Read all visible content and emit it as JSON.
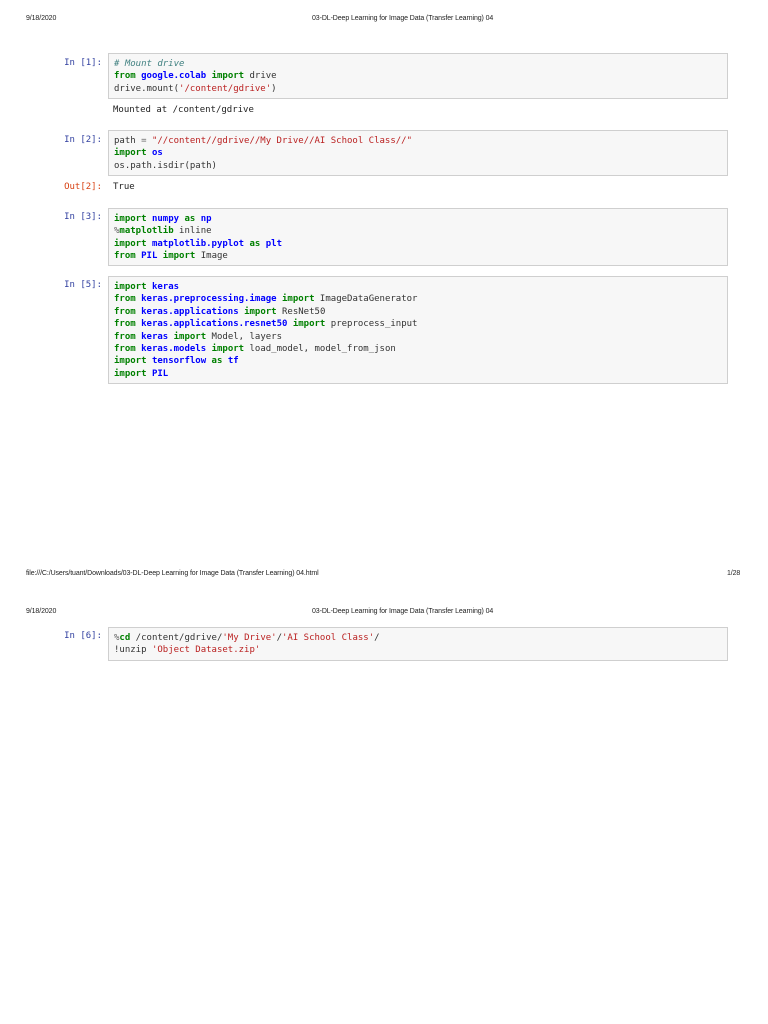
{
  "pages": [
    {
      "date": "9/18/2020",
      "title": "03-DL-Deep Learning for Image Data (Transfer Learning) 04",
      "footer_path": "file:///C:/Users/tuant/Downloads/03-DL-Deep Learning for Image Data (Transfer Learning) 04.html",
      "page_number": "1/28"
    },
    {
      "date": "9/18/2020",
      "title": "03-DL-Deep Learning for Image Data (Transfer Learning) 04"
    }
  ],
  "cells": [
    {
      "prompt": "In [1]:",
      "lines": [
        [
          [
            "# Mount drive",
            "c"
          ]
        ],
        [
          [
            "from",
            "k"
          ],
          [
            " ",
            ""
          ],
          [
            "google.colab",
            "n"
          ],
          [
            " ",
            ""
          ],
          [
            "import",
            "k"
          ],
          [
            " drive",
            ""
          ]
        ],
        [
          [
            "drive.mount(",
            ""
          ],
          [
            "'/content/gdrive'",
            "s"
          ],
          [
            ")",
            ""
          ]
        ]
      ],
      "output": "Mounted at /content/gdrive"
    },
    {
      "prompt": "In [2]:",
      "lines": [
        [
          [
            "path ",
            ""
          ],
          [
            "=",
            "o"
          ],
          [
            " ",
            ""
          ],
          [
            "\"//content//gdrive//My Drive//AI School Class//\"",
            "s"
          ]
        ],
        [
          [
            "import",
            "k"
          ],
          [
            " ",
            ""
          ],
          [
            "os",
            "n"
          ]
        ],
        [
          [
            "os.path.isdir(path)",
            ""
          ]
        ]
      ],
      "out_prompt": "Out[2]:",
      "output": "True"
    },
    {
      "prompt": "In [3]:",
      "lines": [
        [
          [
            "import",
            "k"
          ],
          [
            " ",
            ""
          ],
          [
            "numpy",
            "n"
          ],
          [
            " ",
            ""
          ],
          [
            "as",
            "k"
          ],
          [
            " ",
            ""
          ],
          [
            "np",
            "n"
          ]
        ],
        [
          [
            "%",
            "o"
          ],
          [
            "matplotlib",
            "k"
          ],
          [
            " inline",
            ""
          ]
        ],
        [
          [
            "import",
            "k"
          ],
          [
            " ",
            ""
          ],
          [
            "matplotlib.pyplot",
            "n"
          ],
          [
            " ",
            ""
          ],
          [
            "as",
            "k"
          ],
          [
            " ",
            ""
          ],
          [
            "plt",
            "n"
          ]
        ],
        [
          [
            "from",
            "k"
          ],
          [
            " ",
            ""
          ],
          [
            "PIL",
            "n"
          ],
          [
            " ",
            ""
          ],
          [
            "import",
            "k"
          ],
          [
            " Image",
            ""
          ]
        ]
      ]
    },
    {
      "prompt": "In [5]:",
      "lines": [
        [
          [
            "import",
            "k"
          ],
          [
            " ",
            ""
          ],
          [
            "keras",
            "n"
          ]
        ],
        [
          [
            "from",
            "k"
          ],
          [
            " ",
            ""
          ],
          [
            "keras.preprocessing.image",
            "n"
          ],
          [
            " ",
            ""
          ],
          [
            "import",
            "k"
          ],
          [
            " ImageDataGenerator",
            ""
          ]
        ],
        [
          [
            "from",
            "k"
          ],
          [
            " ",
            ""
          ],
          [
            "keras.applications",
            "n"
          ],
          [
            " ",
            ""
          ],
          [
            "import",
            "k"
          ],
          [
            " ResNet50",
            ""
          ]
        ],
        [
          [
            "from",
            "k"
          ],
          [
            " ",
            ""
          ],
          [
            "keras.applications.resnet50",
            "n"
          ],
          [
            " ",
            ""
          ],
          [
            "import",
            "k"
          ],
          [
            " preprocess_input",
            ""
          ]
        ],
        [
          [
            "from",
            "k"
          ],
          [
            " ",
            ""
          ],
          [
            "keras",
            "n"
          ],
          [
            " ",
            ""
          ],
          [
            "import",
            "k"
          ],
          [
            " Model, layers",
            ""
          ]
        ],
        [
          [
            "from",
            "k"
          ],
          [
            " ",
            ""
          ],
          [
            "keras.models",
            "n"
          ],
          [
            " ",
            ""
          ],
          [
            "import",
            "k"
          ],
          [
            " load_model, model_from_json",
            ""
          ]
        ],
        [
          [
            "import",
            "k"
          ],
          [
            " ",
            ""
          ],
          [
            "tensorflow",
            "n"
          ],
          [
            " ",
            ""
          ],
          [
            "as",
            "k"
          ],
          [
            " ",
            ""
          ],
          [
            "tf",
            "n"
          ]
        ],
        [
          [
            "import",
            "k"
          ],
          [
            " ",
            ""
          ],
          [
            "PIL",
            "n"
          ]
        ]
      ]
    },
    {
      "prompt": "In [6]:",
      "lines": [
        [
          [
            "%",
            "o"
          ],
          [
            "cd",
            "k"
          ],
          [
            " /content/gdrive/",
            ""
          ],
          [
            "'My Drive'",
            "s"
          ],
          [
            "/",
            ""
          ],
          [
            "'AI School Class'",
            "s"
          ],
          [
            "/",
            ""
          ]
        ],
        [
          [
            "!unzip ",
            ""
          ],
          [
            "'Object Dataset.zip'",
            "s"
          ]
        ]
      ]
    }
  ]
}
